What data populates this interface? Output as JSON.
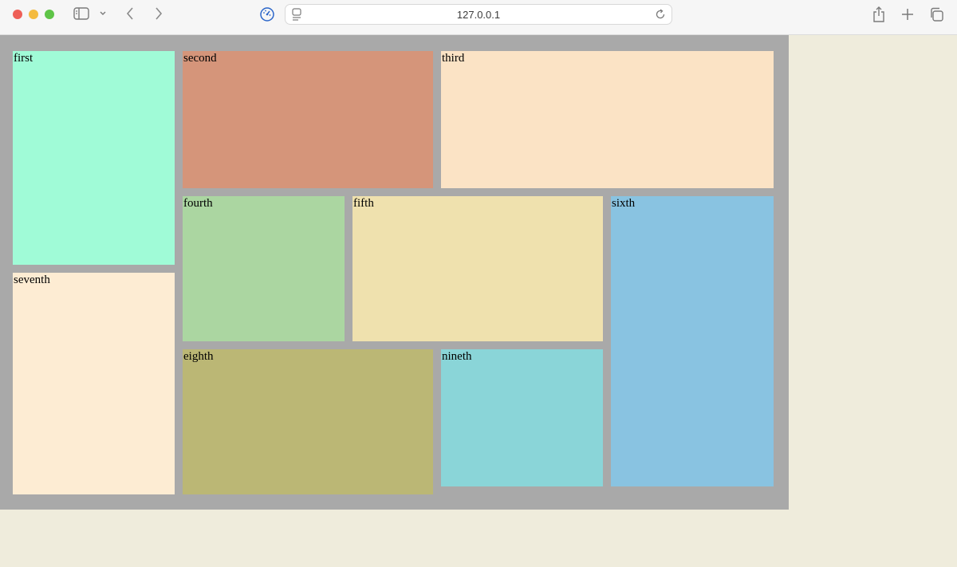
{
  "browser": {
    "url": "127.0.0.1"
  },
  "icons": {
    "sidebar": "sidebar-icon",
    "chevron": "chevron-down-icon",
    "back": "chevron-left-icon",
    "forward": "chevron-right-icon",
    "privacy": "privacy-report-icon",
    "page": "page-icon",
    "reload": "reload-icon",
    "share": "share-icon",
    "new_tab": "plus-icon",
    "tab_overview": "tab-overview-icon"
  },
  "colors": {
    "page_background": "#efecdc",
    "container_background": "#a9a9a9"
  },
  "boxes": [
    {
      "label": "first",
      "color": "#a0fbd7"
    },
    {
      "label": "second",
      "color": "#d5957a"
    },
    {
      "label": "third",
      "color": "#fbe3c5"
    },
    {
      "label": "fourth",
      "color": "#abd6a1"
    },
    {
      "label": "fifth",
      "color": "#efe1ae"
    },
    {
      "label": "sixth",
      "color": "#89c3e1"
    },
    {
      "label": "seventh",
      "color": "#fdecd3"
    },
    {
      "label": "eighth",
      "color": "#bbb775"
    },
    {
      "label": "nineth",
      "color": "#8ad5d8"
    }
  ]
}
